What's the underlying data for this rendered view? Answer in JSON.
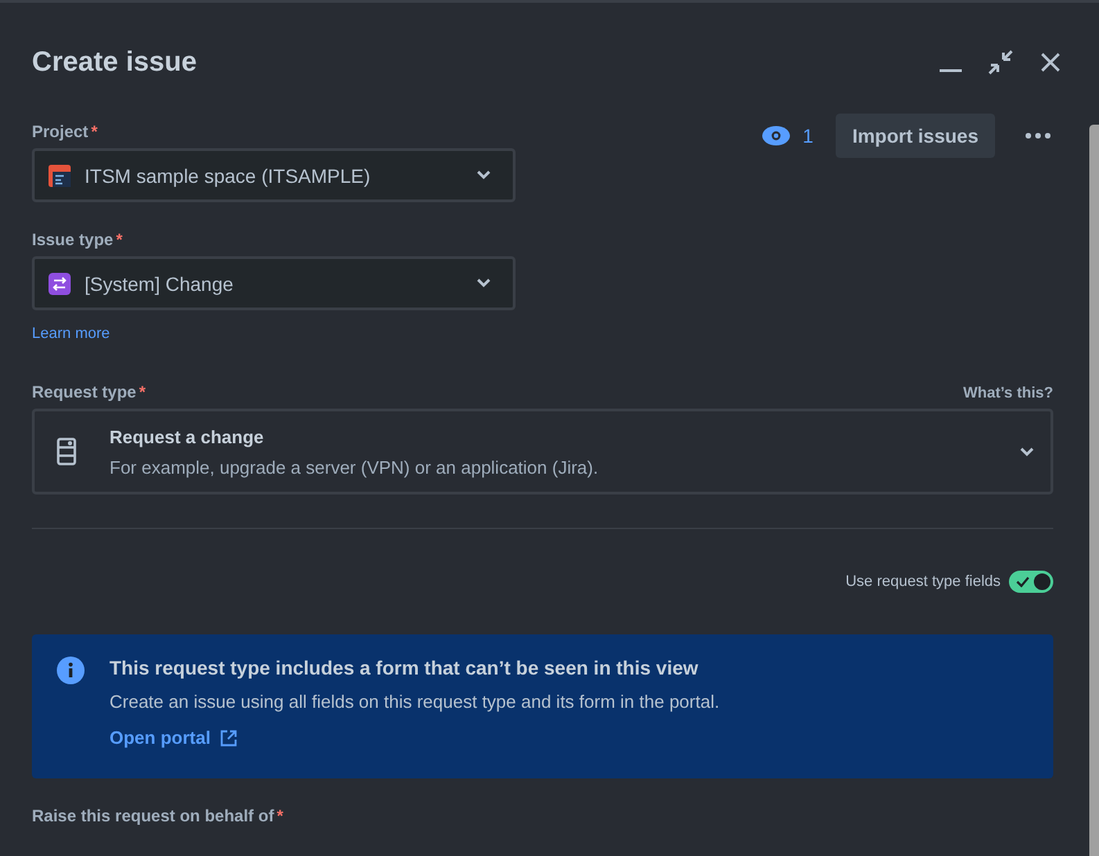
{
  "window": {
    "title": "Create issue"
  },
  "toolbar": {
    "watchers": "1",
    "import_button": "Import issues"
  },
  "project": {
    "label": "Project",
    "required_marker": "*",
    "value": "ITSM sample space (ITSAMPLE)"
  },
  "issue_type": {
    "label": "Issue type",
    "required_marker": "*",
    "value": "[System] Change",
    "link": "Learn more"
  },
  "request_type": {
    "label": "Request type",
    "required_marker": "*",
    "help_link": "What’s this?",
    "title": "Request a change",
    "description": "For example, upgrade a server (VPN) or an application (Jira)."
  },
  "use_request_type_fields": {
    "label": "Use request type fields",
    "on": true
  },
  "info_banner": {
    "title": "This request type includes a form that can’t be seen in this view",
    "text": "Create an issue using all fields on this request type and its form in the portal.",
    "link": "Open portal"
  },
  "on_behalf": {
    "label": "Raise this request on behalf of",
    "required_marker": "*"
  }
}
